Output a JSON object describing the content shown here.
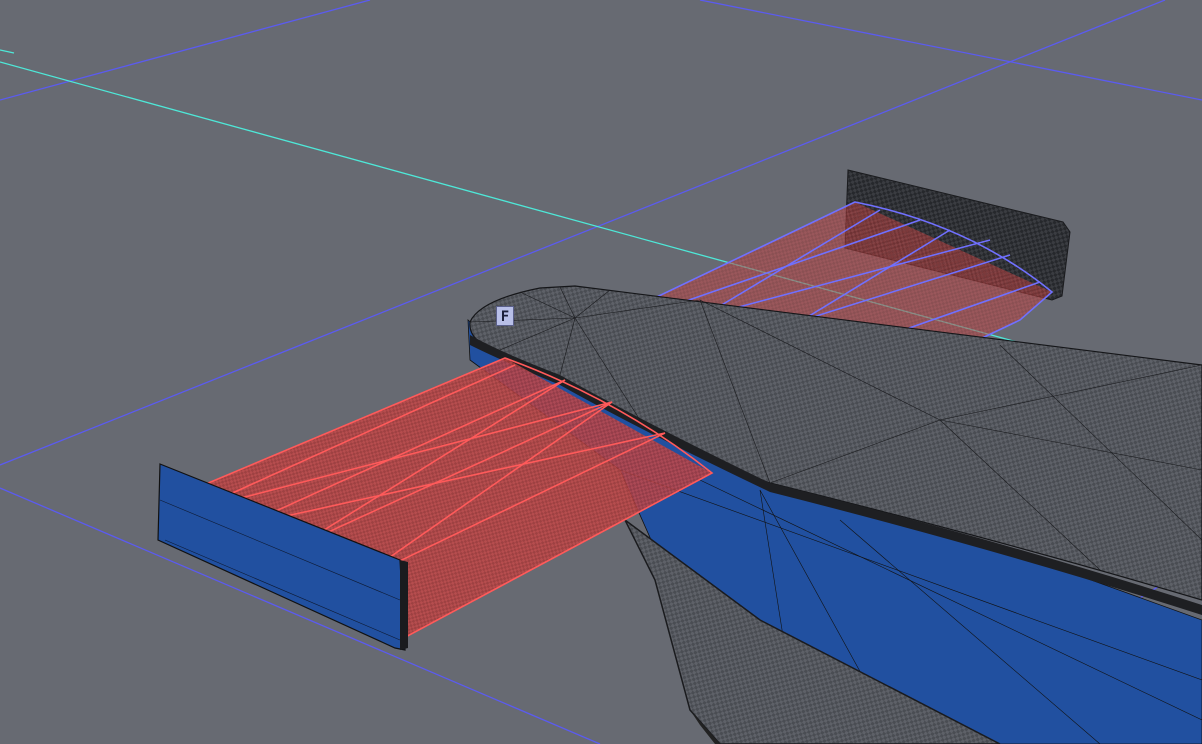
{
  "viewport": {
    "view_label": "F",
    "background_color": "#676a72",
    "grid_color": "#5b5bf0",
    "axis_color": "#4ee8d8",
    "selected_color": "#ff5a5a",
    "hover_color": "#7070ff",
    "model_face_color": "#2150a0",
    "carbon_color": "#55585f"
  }
}
